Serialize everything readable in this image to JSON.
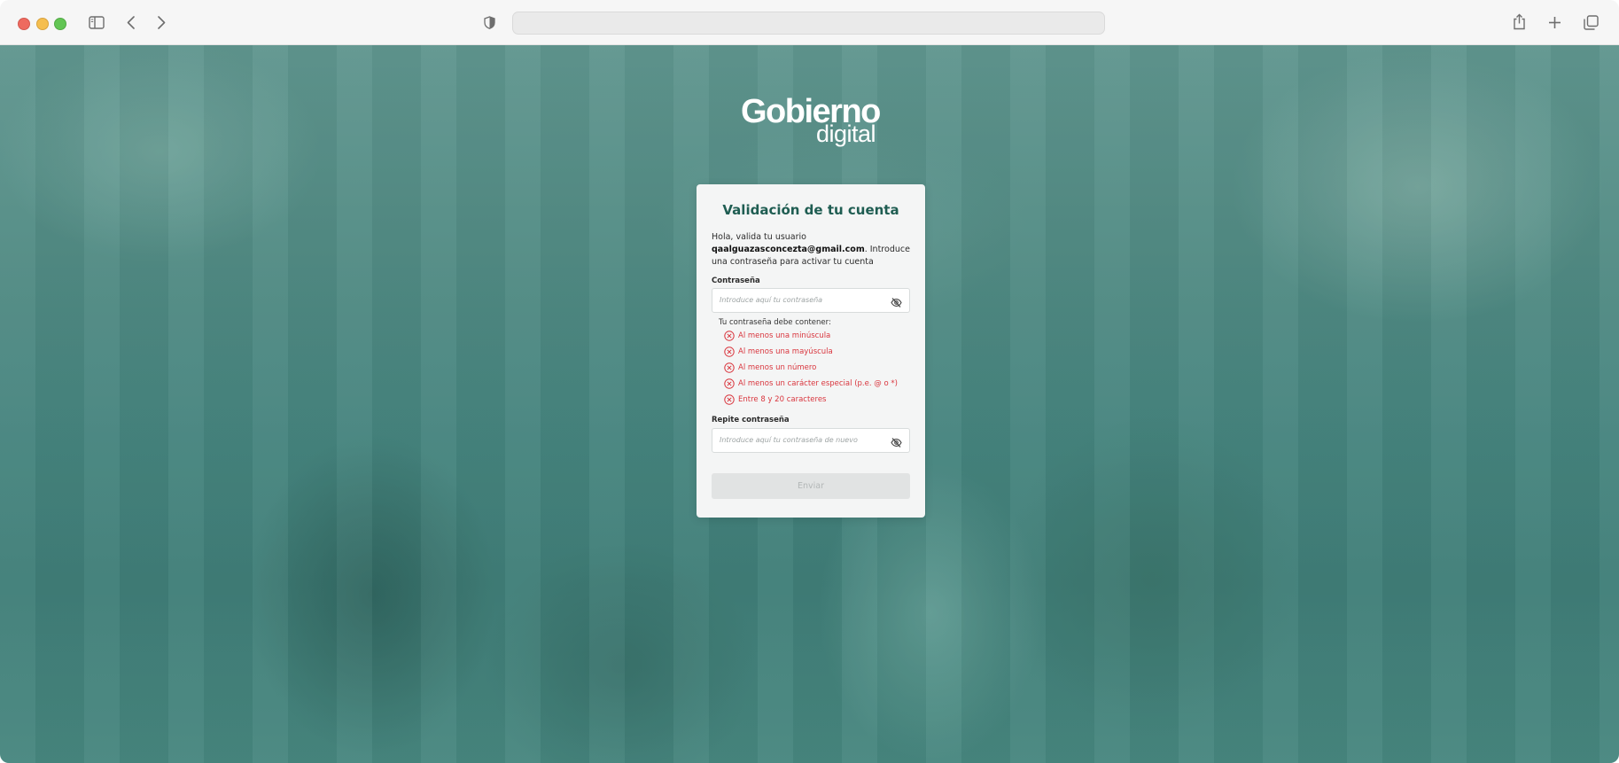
{
  "browser": {
    "address": ""
  },
  "brand": {
    "logo_line1": "Gobierno",
    "logo_line2": "digital"
  },
  "form": {
    "title": "Validación de tu cuenta",
    "intro_prefix": "Hola, valida tu usuario ",
    "email": "qaalguazasconcezta@gmail.com",
    "intro_suffix": ". Introduce una contraseña para activar tu cuenta",
    "password_label": "Contraseña",
    "password_placeholder": "Introduce aquí tu contraseña",
    "requirements_title": "Tu contraseña debe contener:",
    "requirements": [
      "Al menos una minúscula",
      "Al menos una mayúscula",
      "Al menos un número",
      "Al menos un carácter especial (p.e. @ o *)",
      "Entre 8 y 20 caracteres"
    ],
    "repeat_label": "Repite contraseña",
    "repeat_placeholder": "Introduce aquí tu contraseña de nuevo",
    "submit_label": "Enviar"
  },
  "colors": {
    "title": "#1f5d52",
    "error": "#d9363e",
    "overlay": "#4d8782"
  }
}
